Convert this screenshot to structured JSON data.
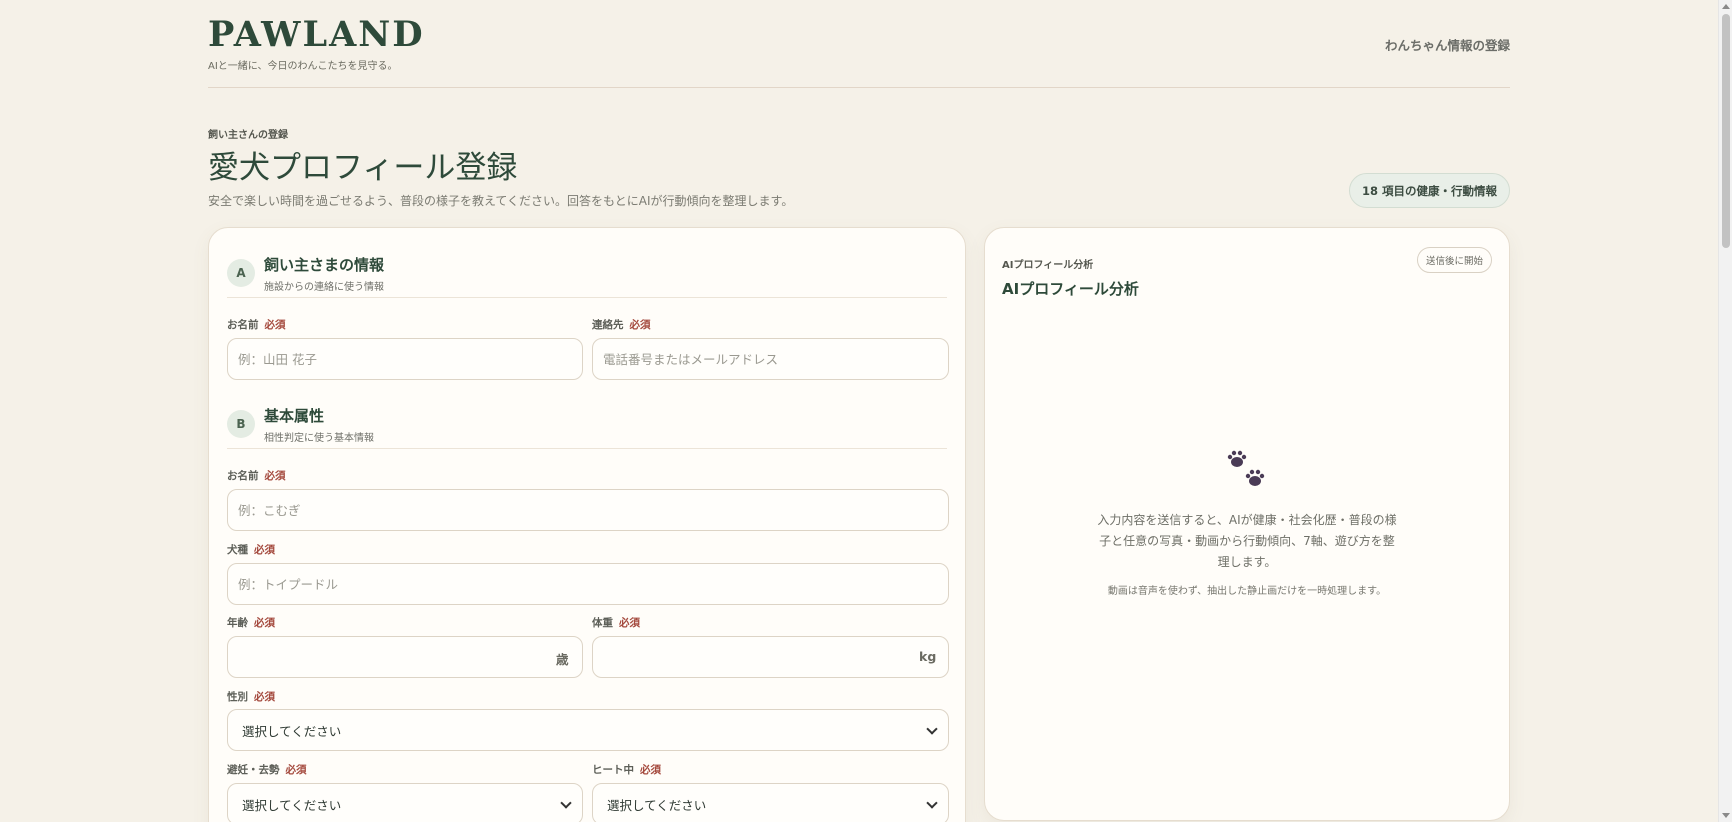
{
  "header": {
    "logo": "PAWLAND",
    "tagline": "AIと一緒に、今日のわんこたちを見守る。",
    "nav_link": "わんちゃん情報の登録"
  },
  "hero": {
    "eyebrow": "飼い主さんの登録",
    "title": "愛犬プロフィール登録",
    "description": "安全で楽しい時間を過ごせるよう、普段の様子を教えてください。回答をもとにAIが行動傾向を整理します。",
    "badge": "18 項目の健康・行動情報"
  },
  "form": {
    "owner_section": {
      "letter": "A",
      "title": "飼い主さまの情報",
      "subtitle": "施設からの連絡に使う情報",
      "name_label": "お名前",
      "name_placeholder": "例：山田 花子",
      "contact_label": "連絡先",
      "contact_placeholder": "電話番号またはメールアドレス"
    },
    "basic_section": {
      "letter": "B",
      "title": "基本属性",
      "subtitle": "相性判定に使う基本情報",
      "dog_name_label": "お名前",
      "dog_name_placeholder": "例：こむぎ",
      "breed_label": "犬種",
      "breed_placeholder": "例：トイプードル",
      "age_label": "年齢",
      "age_unit": "歳",
      "weight_label": "体重",
      "weight_unit": "kg",
      "sex_label": "性別",
      "sex_value": "選択してください",
      "neuter_label": "避妊・去勢",
      "neuter_value": "選択してください",
      "heat_label": "ヒート中",
      "heat_value": "選択してください"
    },
    "required_mark": "必須"
  },
  "ai_panel": {
    "eyebrow": "AIプロフィール分析",
    "title": "AIプロフィール分析",
    "status": "送信後に開始",
    "icon": "paw-icon",
    "message": "入力内容を送信すると、AIが健康・社会化歴・普段の様子と任意の写真・動画から行動傾向、7軸、遊び方を整理します。",
    "note": "動画は音声を使わず、抽出した静止画だけを一時処理します。"
  }
}
